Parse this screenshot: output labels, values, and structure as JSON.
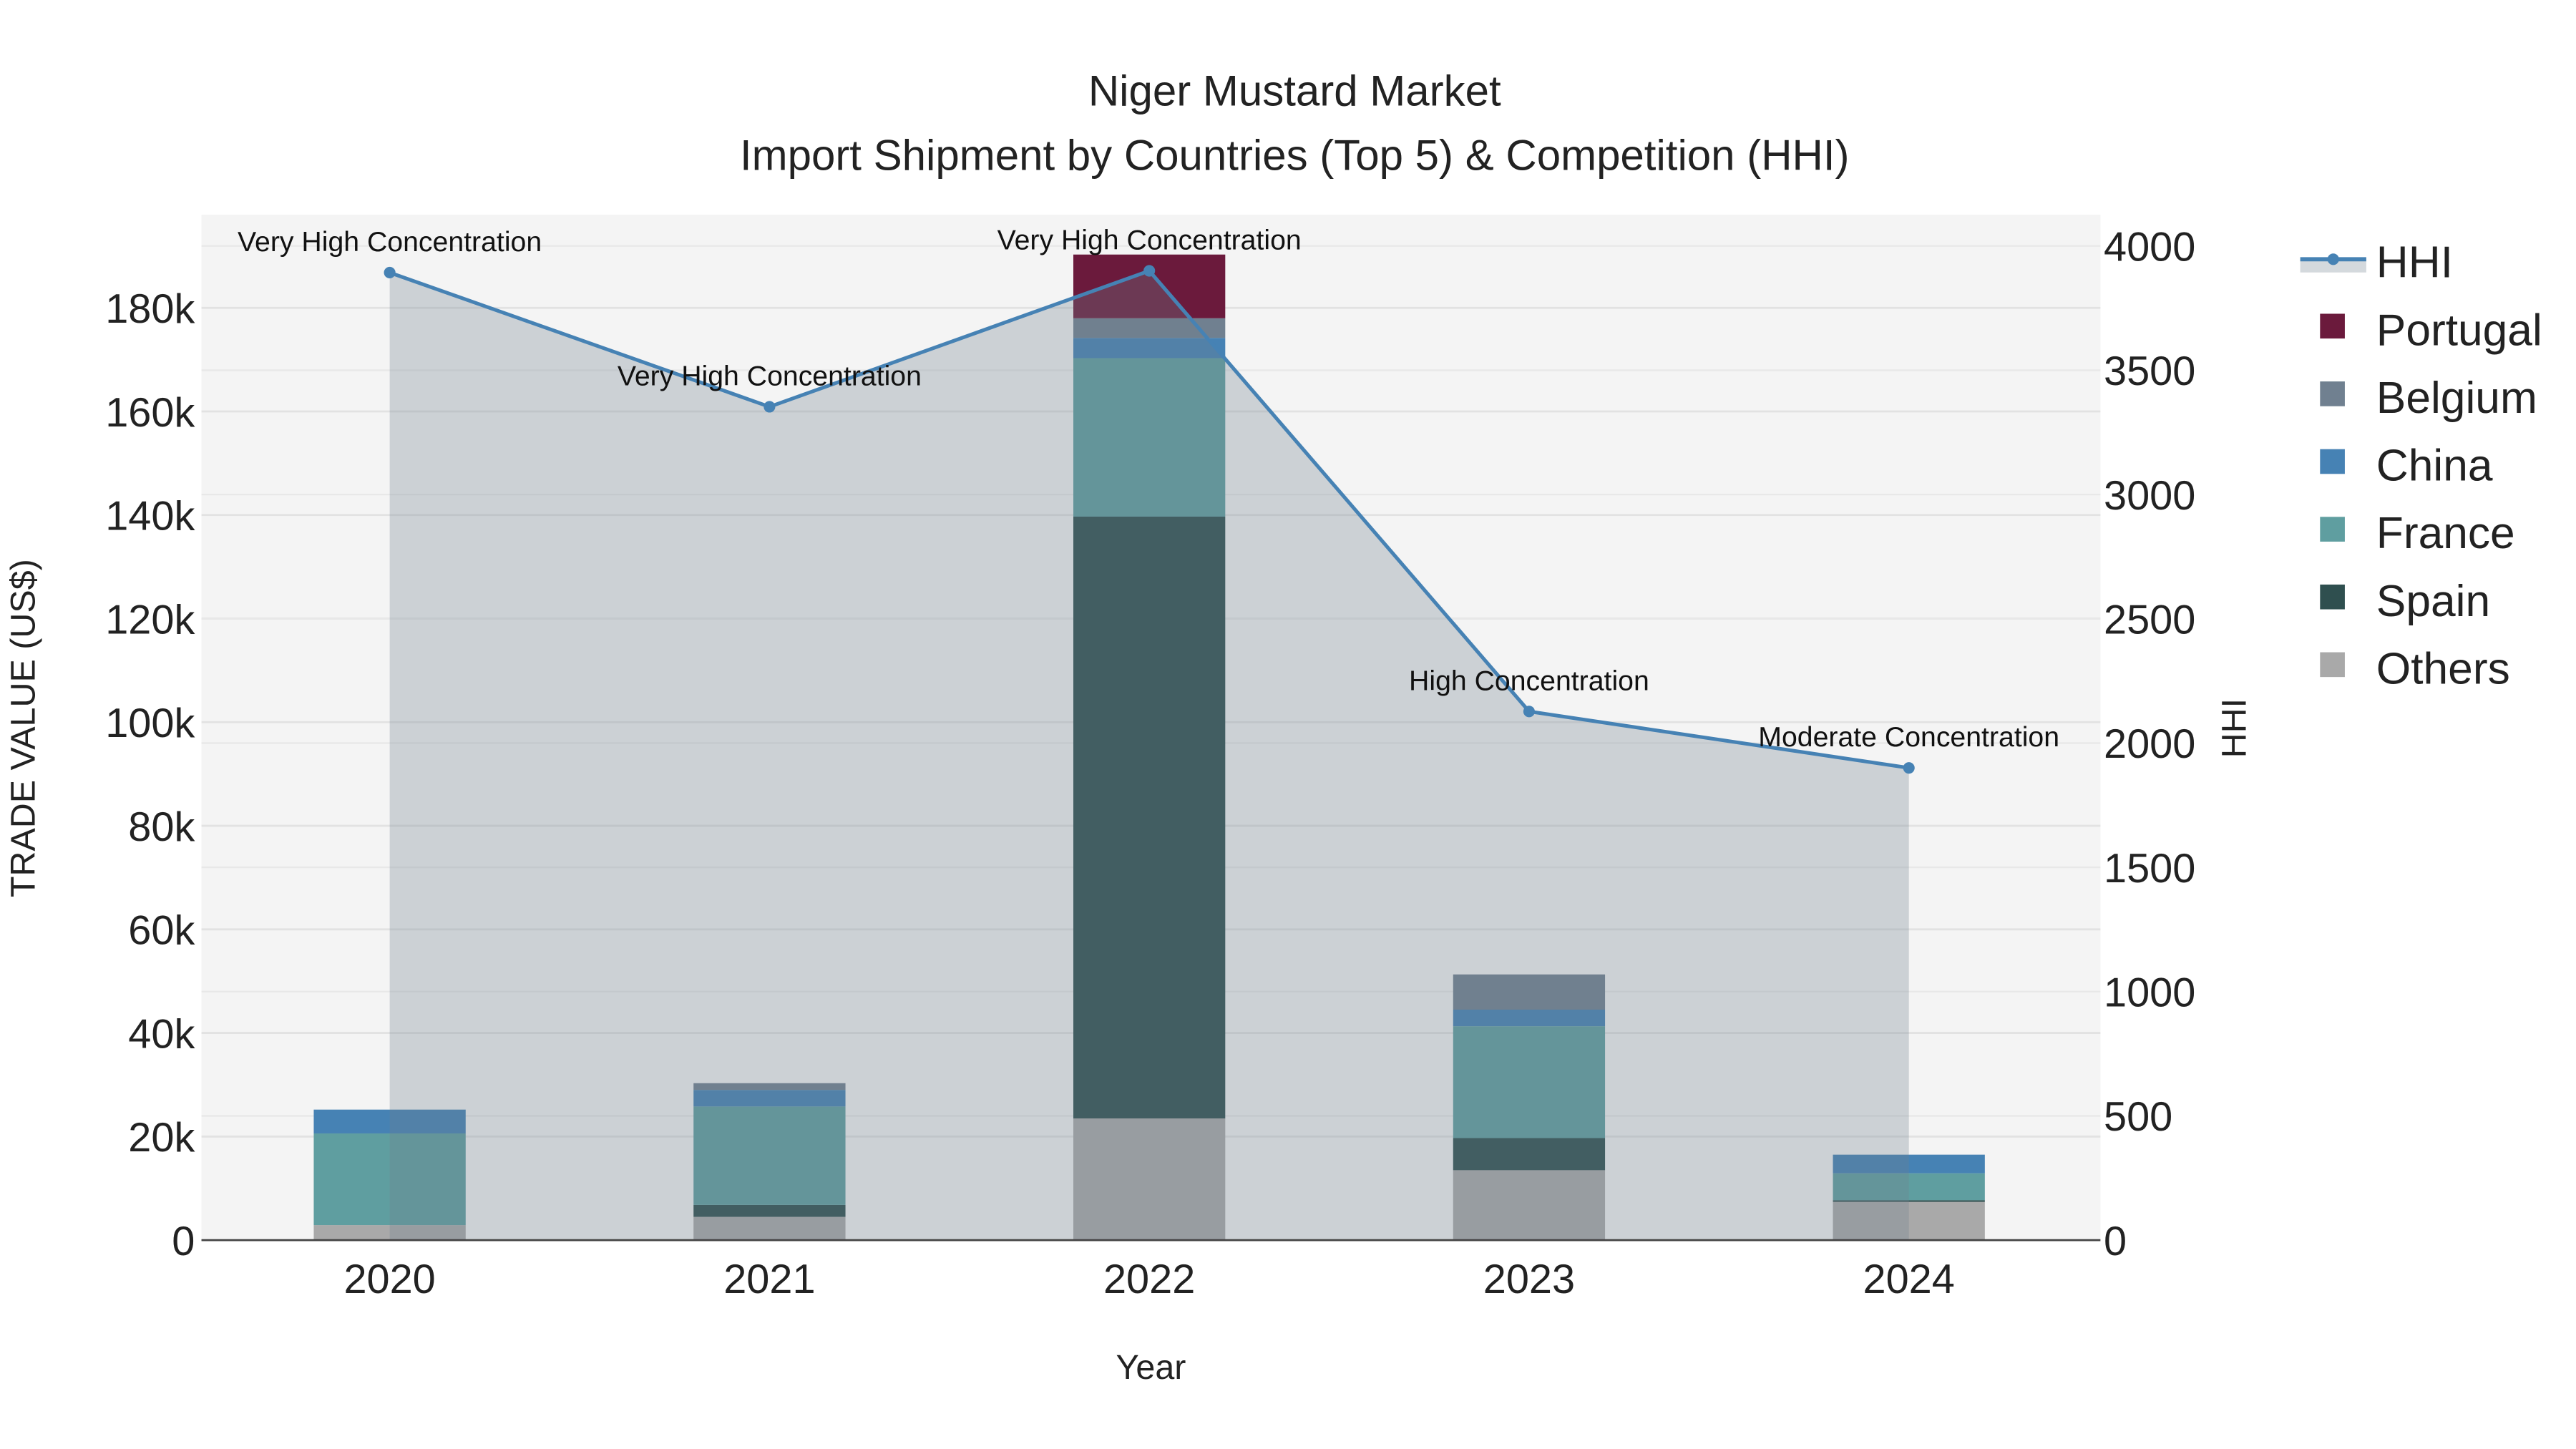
{
  "chart_data": {
    "type": "bar",
    "stacked": true,
    "title": "Niger Mustard Market",
    "subtitle": "Import Shipment by Countries (Top 5) & Competition (HHI)",
    "xlabel": "Year",
    "ylabel": "TRADE VALUE (US$)",
    "y2label": "HHI",
    "categories": [
      "2020",
      "2021",
      "2022",
      "2023",
      "2024"
    ],
    "ylim": [
      0,
      198000
    ],
    "yticks": [
      0,
      20000,
      40000,
      60000,
      80000,
      100000,
      120000,
      140000,
      160000,
      180000
    ],
    "ytick_labels": [
      "0",
      "20k",
      "40k",
      "60k",
      "80k",
      "100k",
      "120k",
      "140k",
      "160k",
      "180k"
    ],
    "y2lim": [
      0,
      4126
    ],
    "y2ticks": [
      0,
      500,
      1000,
      1500,
      2000,
      2500,
      3000,
      3500,
      4000
    ],
    "y2tick_labels": [
      "0",
      "500",
      "1000",
      "1500",
      "2000",
      "2500",
      "3000",
      "3500",
      "4000"
    ],
    "grid": true,
    "legend_position": "right",
    "series": [
      {
        "name": "Others",
        "color": "#A9A9A9",
        "values": [
          2900,
          4500,
          23500,
          13500,
          7400
        ]
      },
      {
        "name": "Spain",
        "color": "#2F4F4F",
        "values": [
          0,
          2300,
          116200,
          6200,
          300
        ]
      },
      {
        "name": "France",
        "color": "#5F9EA0",
        "values": [
          17700,
          19000,
          30600,
          21600,
          5200
        ]
      },
      {
        "name": "China",
        "color": "#4682B4",
        "values": [
          4600,
          3200,
          3900,
          3200,
          3600
        ]
      },
      {
        "name": "Belgium",
        "color": "#708090",
        "values": [
          0,
          1300,
          3800,
          6800,
          0
        ]
      },
      {
        "name": "Portugal",
        "color": "#6B1A3C",
        "values": [
          0,
          0,
          12300,
          0,
          0
        ]
      }
    ],
    "hhi": {
      "name": "HHI",
      "color": "#4682B4",
      "values": [
        3893,
        3353,
        3900,
        2127,
        1900
      ],
      "annotations": [
        "Very High Concentration",
        "Very High Concentration",
        "Very High Concentration",
        "High Concentration",
        "Moderate Concentration"
      ]
    },
    "legend_order": [
      "HHI",
      "Portugal",
      "Belgium",
      "China",
      "France",
      "Spain",
      "Others"
    ]
  }
}
